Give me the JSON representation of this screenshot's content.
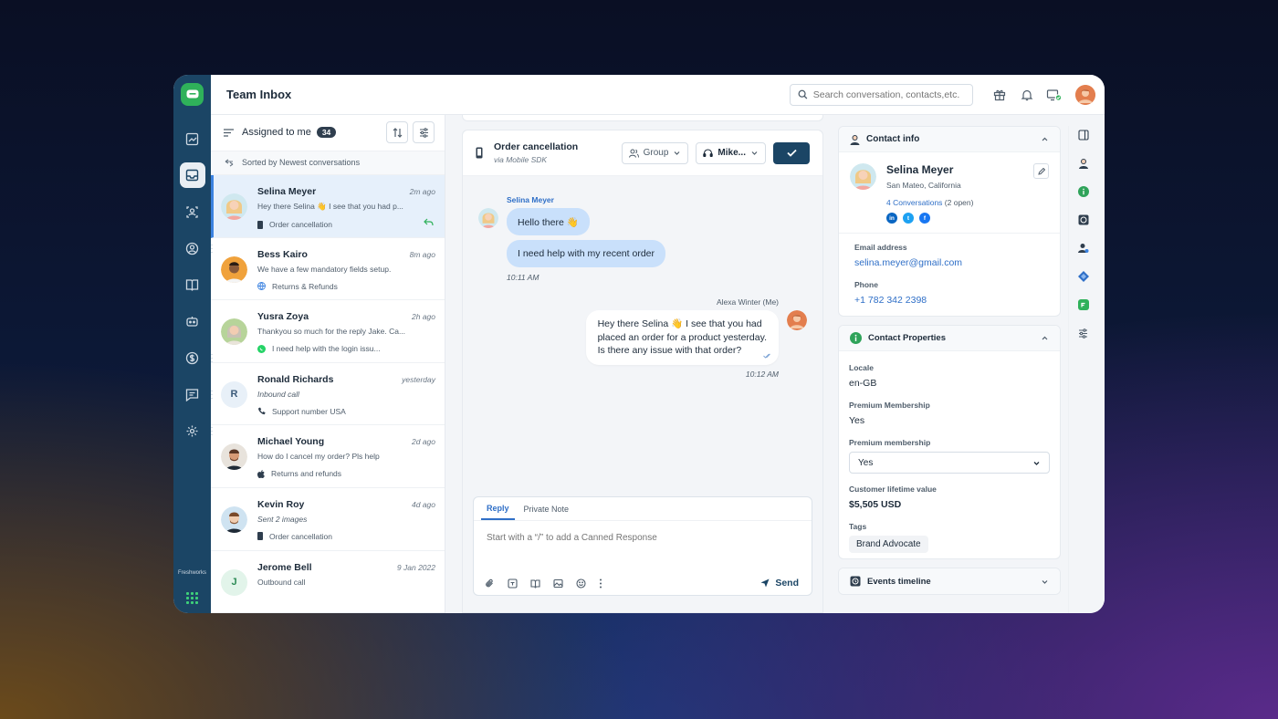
{
  "app": {
    "title": "Team Inbox",
    "search_placeholder": "Search conversation, contacts,etc.",
    "brand_color": "#1b4565",
    "accent_color": "#2f6fc7",
    "rail_label": "Freshworks"
  },
  "list": {
    "filter_label": "Assigned to me",
    "count": "34",
    "sort_label": "Sorted by Newest conversations",
    "conversations": [
      {
        "name": "Selina Meyer",
        "time": "2m ago",
        "snippet": "Hey there Selina 👋 I see that you had p...",
        "channel": "Order cancellation",
        "channel_icon": "mobile-icon",
        "selected": true
      },
      {
        "name": "Bess Kairo",
        "time": "8m ago",
        "snippet": "We have a few mandatory fields setup.",
        "channel": "Returns & Refunds",
        "channel_icon": "globe-icon"
      },
      {
        "name": "Yusra Zoya",
        "time": "2h ago",
        "snippet": "Thankyou so much for the reply Jake. Ca...",
        "channel": "I need help with the login issu...",
        "channel_icon": "whatsapp-icon"
      },
      {
        "name": "Ronald Richards",
        "initial": "R",
        "time": "yesterday",
        "snippet": "Inbound call",
        "channel": "Support number USA",
        "channel_icon": "phone-icon"
      },
      {
        "name": "Michael Young",
        "time": "2d ago",
        "snippet": "How do I cancel my order? Pls help",
        "channel": "Returns and refunds",
        "channel_icon": "apple-icon"
      },
      {
        "name": "Kevin Roy",
        "time": "4d ago",
        "snippet": "Sent 2 images",
        "channel": "Order cancellation",
        "channel_icon": "mobile-icon"
      },
      {
        "name": "Jerome Bell",
        "initial": "J",
        "time": "9 Jan 2022",
        "snippet": "Outbound call",
        "channel": "",
        "channel_icon": ""
      }
    ]
  },
  "chat": {
    "title": "Order cancellation",
    "subtitle": "via Mobile SDK",
    "group_label": "Group",
    "agent_label": "Mike...",
    "messages": {
      "in_sender": "Selina Meyer",
      "in_1": "Hello there 👋",
      "in_2": "I need help with my recent order",
      "in_time": "10:11 AM",
      "out_sender": "Alexa Winter (Me)",
      "out_line1": "Hey there Selina 👋 I see that you had",
      "out_line2": "placed an order for a product yesterday.",
      "out_line3": "Is there any issue with that order?",
      "out_time": "10:12 AM"
    },
    "composer": {
      "tab_reply": "Reply",
      "tab_note": "Private Note",
      "placeholder": "Start with a “/” to add a Canned Response",
      "send_label": "Send"
    }
  },
  "contact": {
    "section_title": "Contact info",
    "name": "Selina Meyer",
    "location": "San Mateo, California",
    "conversations": "4 Conversations",
    "open": "(2 open)",
    "email_label": "Email address",
    "email": "selina.meyer@gmail.com",
    "phone_label": "Phone",
    "phone": "+1 782 342 2398",
    "socials": [
      {
        "label": "in",
        "color": "#0a66c2"
      },
      {
        "label": "t",
        "color": "#1da1f2"
      },
      {
        "label": "f",
        "color": "#1877f2"
      }
    ]
  },
  "properties": {
    "section_title": "Contact Properties",
    "locale_label": "Locale",
    "locale": "en-GB",
    "premium_label": "Premium Membership",
    "premium": "Yes",
    "premium2_label": "Premium membership",
    "premium2_value": "Yes",
    "ltv_label": "Customer lifetime value",
    "ltv": "$5,505 USD",
    "tags_label": "Tags",
    "tag": "Brand Advocate"
  },
  "events": {
    "section_title": "Events timeline"
  }
}
